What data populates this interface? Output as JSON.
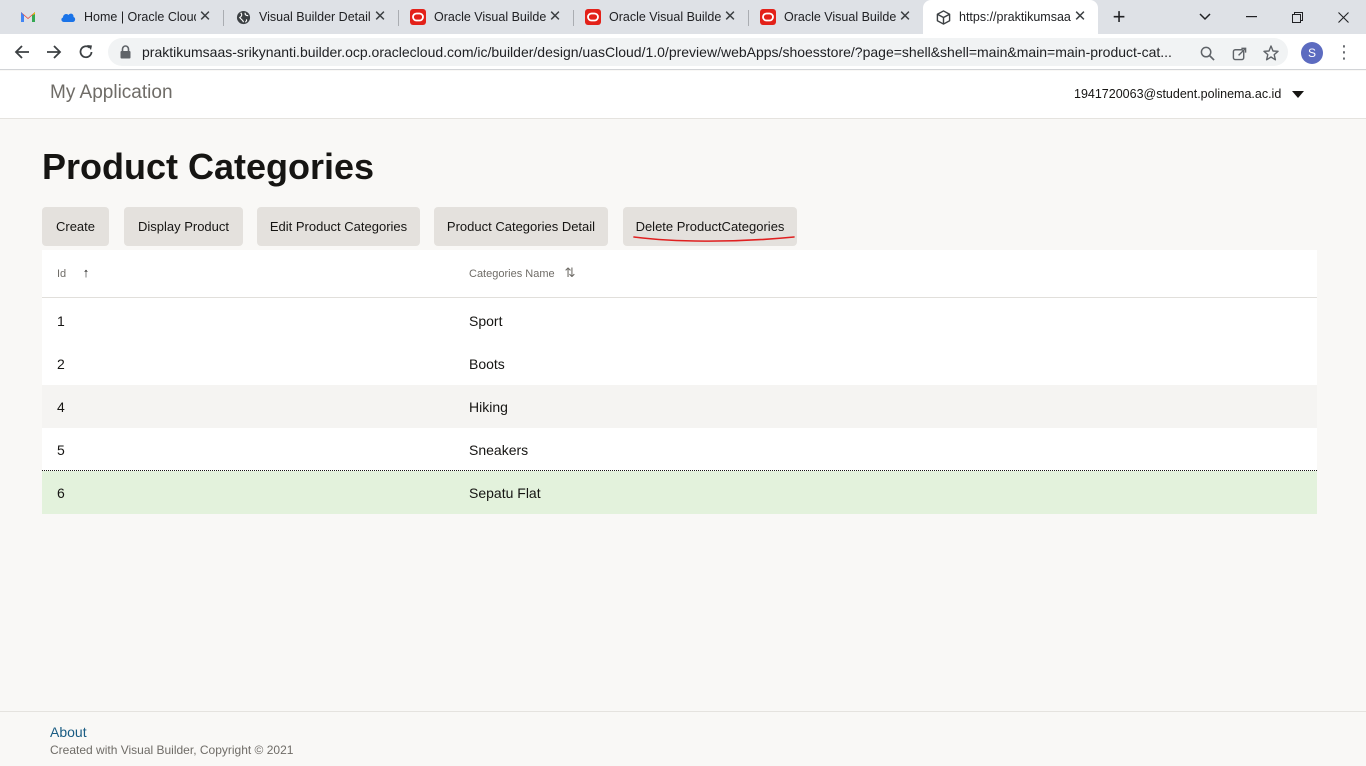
{
  "browser": {
    "tabs": [
      {
        "label": "",
        "icon": "gmail-icon"
      },
      {
        "label": "Home | Oracle Cloud",
        "icon": "cloud-icon"
      },
      {
        "label": "Visual Builder Details",
        "icon": "globe-icon"
      },
      {
        "label": "Oracle Visual Builder",
        "icon": "oracle-icon"
      },
      {
        "label": "Oracle Visual Builder",
        "icon": "oracle-icon"
      },
      {
        "label": "Oracle Visual Builder",
        "icon": "oracle-icon"
      },
      {
        "label": "https://praktikumsaas",
        "icon": "cube-icon"
      }
    ],
    "url": "praktikumsaas-srikynanti.builder.ocp.oraclecloud.com/ic/builder/design/uasCloud/1.0/preview/webApps/shoesstore/?page=shell&shell=main&main=main-product-cat...",
    "profile_initial": "S"
  },
  "app": {
    "title": "My Application",
    "user": "1941720063@student.polinema.ac.id"
  },
  "page": {
    "title": "Product Categories",
    "buttons": [
      "Create",
      "Display Product",
      "Edit Product Categories",
      "Product Categories Detail",
      "Delete ProductCategories"
    ]
  },
  "table": {
    "columns": [
      "Id",
      "Categories Name"
    ],
    "rows": [
      {
        "id": "1",
        "name": "Sport"
      },
      {
        "id": "2",
        "name": "Boots"
      },
      {
        "id": "4",
        "name": "Hiking"
      },
      {
        "id": "5",
        "name": "Sneakers"
      },
      {
        "id": "6",
        "name": "Sepatu Flat"
      }
    ]
  },
  "footer": {
    "about": "About",
    "copyright": "Created with Visual Builder, Copyright © 2021"
  },
  "colors": {
    "selected_row": "#e3f2dc",
    "hover_row": "#f5f4f2",
    "annotation": "#e02020",
    "oracle_red": "#e32119"
  }
}
